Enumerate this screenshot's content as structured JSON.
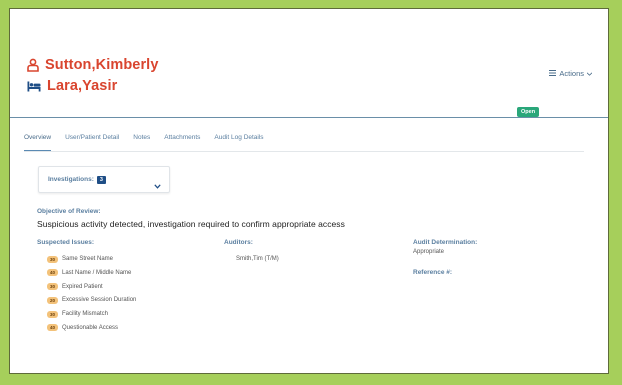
{
  "patients": [
    {
      "name": "Sutton,Kimberly",
      "icon": "user-icon"
    },
    {
      "name": "Lara,Yasir",
      "icon": "bed-icon"
    }
  ],
  "actions_label": "Actions",
  "status": "Open",
  "colors": {
    "accent": "#d9452f",
    "status": "#2aa77a",
    "link": "#5b7fa0",
    "badge": "#f3c27a",
    "count": "#1f4e86"
  },
  "tabs": [
    {
      "label": "Overview",
      "active": true
    },
    {
      "label": "User/Patient Detail"
    },
    {
      "label": "Notes"
    },
    {
      "label": "Attachments"
    },
    {
      "label": "Audit Log Details"
    }
  ],
  "investigations": {
    "label": "Investigations:",
    "count": "3"
  },
  "objective": {
    "label": "Objective of Review:",
    "text": "Suspicious activity detected, investigation required to confirm appropriate access"
  },
  "suspected_issues": {
    "label": "Suspected Issues:",
    "items": [
      {
        "score": "30",
        "text": "Same Street Name"
      },
      {
        "score": "40",
        "text": "Last Name / Middle Name"
      },
      {
        "score": "30",
        "text": "Expired Patient"
      },
      {
        "score": "20",
        "text": "Excessive Session Duration"
      },
      {
        "score": "30",
        "text": "Facility Mismatch"
      },
      {
        "score": "40",
        "text": "Questionable Access"
      }
    ]
  },
  "auditors": {
    "label": "Auditors:",
    "value": "Smith,Tim (T/M)"
  },
  "audit_determination": {
    "label": "Audit Determination:",
    "value": "Appropriate"
  },
  "reference": {
    "label": "Reference #:"
  }
}
